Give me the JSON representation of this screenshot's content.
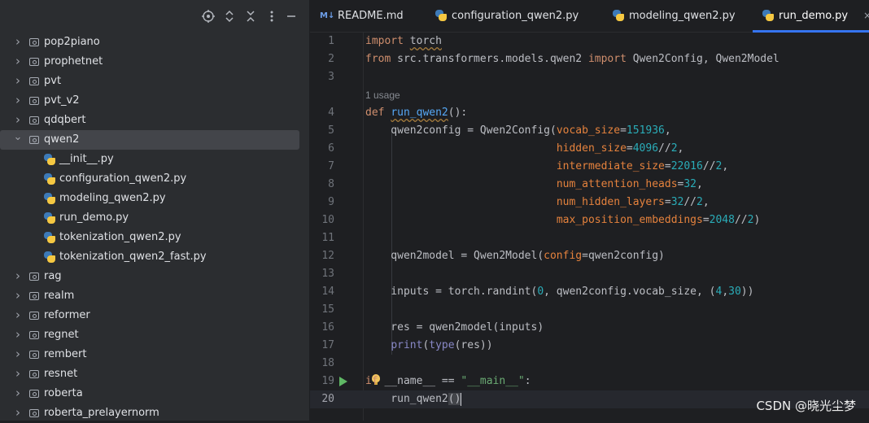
{
  "project": {
    "toolbar": {
      "locate_icon": "crosshair-icon",
      "expand_icon": "expand-collapse-icon",
      "collapse_icon": "collapse-all-icon",
      "options_icon": "more-vertical-icon",
      "hide_icon": "minimize-icon"
    },
    "tree": [
      {
        "type": "folder",
        "label": "pop2piano",
        "expanded": false
      },
      {
        "type": "folder",
        "label": "prophetnet",
        "expanded": false
      },
      {
        "type": "folder",
        "label": "pvt",
        "expanded": false
      },
      {
        "type": "folder",
        "label": "pvt_v2",
        "expanded": false
      },
      {
        "type": "folder",
        "label": "qdqbert",
        "expanded": false
      },
      {
        "type": "folder",
        "label": "qwen2",
        "expanded": true,
        "selected": true
      },
      {
        "type": "file",
        "label": "__init__.py"
      },
      {
        "type": "file",
        "label": "configuration_qwen2.py"
      },
      {
        "type": "file",
        "label": "modeling_qwen2.py"
      },
      {
        "type": "file",
        "label": "run_demo.py"
      },
      {
        "type": "file",
        "label": "tokenization_qwen2.py"
      },
      {
        "type": "file",
        "label": "tokenization_qwen2_fast.py"
      },
      {
        "type": "folder",
        "label": "rag",
        "expanded": false
      },
      {
        "type": "folder",
        "label": "realm",
        "expanded": false
      },
      {
        "type": "folder",
        "label": "reformer",
        "expanded": false
      },
      {
        "type": "folder",
        "label": "regnet",
        "expanded": false
      },
      {
        "type": "folder",
        "label": "rembert",
        "expanded": false
      },
      {
        "type": "folder",
        "label": "resnet",
        "expanded": false
      },
      {
        "type": "folder",
        "label": "roberta",
        "expanded": false
      },
      {
        "type": "folder",
        "label": "roberta_prelayernorm",
        "expanded": false
      }
    ]
  },
  "tabs": [
    {
      "label": "README.md",
      "icon": "M↓",
      "active": false
    },
    {
      "label": "configuration_qwen2.py",
      "icon": "python-icon",
      "active": false
    },
    {
      "label": "modeling_qwen2.py",
      "icon": "python-icon",
      "active": false
    },
    {
      "label": "run_demo.py",
      "icon": "python-icon",
      "active": true,
      "close": "×"
    }
  ],
  "editor": {
    "usage_hint": "1 usage",
    "line_numbers": [
      "1",
      "2",
      "3",
      "4",
      "5",
      "6",
      "7",
      "8",
      "9",
      "10",
      "11",
      "12",
      "13",
      "14",
      "15",
      "16",
      "17",
      "18",
      "19",
      "20"
    ],
    "current_line": "20",
    "lines": [
      [
        [
          "kw",
          "import"
        ],
        [
          "p",
          " "
        ],
        [
          "wp",
          "torch"
        ]
      ],
      [
        [
          "kw",
          "from"
        ],
        [
          "p",
          " src.transformers.models.qwen2 "
        ],
        [
          "kw",
          "import"
        ],
        [
          "p",
          " Qwen2Config, Qwen2Model"
        ]
      ],
      [],
      [
        [
          "kw",
          "def"
        ],
        [
          "p",
          " "
        ],
        [
          "fnw",
          "run_qwen2"
        ],
        [
          "p",
          "():"
        ]
      ],
      [
        [
          "p",
          "    qwen2config = Qwen2Config("
        ],
        [
          "param",
          "vocab_size"
        ],
        [
          "p",
          "="
        ],
        [
          "num",
          "151936"
        ],
        [
          "p",
          ","
        ]
      ],
      [
        [
          "p",
          "                              "
        ],
        [
          "param",
          "hidden_size"
        ],
        [
          "p",
          "="
        ],
        [
          "num",
          "4096"
        ],
        [
          "p",
          "//"
        ],
        [
          "num",
          "2"
        ],
        [
          "p",
          ","
        ]
      ],
      [
        [
          "p",
          "                              "
        ],
        [
          "param",
          "intermediate_size"
        ],
        [
          "p",
          "="
        ],
        [
          "num",
          "22016"
        ],
        [
          "p",
          "//"
        ],
        [
          "num",
          "2"
        ],
        [
          "p",
          ","
        ]
      ],
      [
        [
          "p",
          "                              "
        ],
        [
          "param",
          "num_attention_heads"
        ],
        [
          "p",
          "="
        ],
        [
          "num",
          "32"
        ],
        [
          "p",
          ","
        ]
      ],
      [
        [
          "p",
          "                              "
        ],
        [
          "param",
          "num_hidden_layers"
        ],
        [
          "p",
          "="
        ],
        [
          "num",
          "32"
        ],
        [
          "p",
          "//"
        ],
        [
          "num",
          "2"
        ],
        [
          "p",
          ","
        ]
      ],
      [
        [
          "p",
          "                              "
        ],
        [
          "param",
          "max_position_embeddings"
        ],
        [
          "p",
          "="
        ],
        [
          "num",
          "2048"
        ],
        [
          "p",
          "//"
        ],
        [
          "num",
          "2"
        ],
        [
          "p",
          ")"
        ]
      ],
      [],
      [
        [
          "p",
          "    qwen2model = Qwen2Model("
        ],
        [
          "param",
          "config"
        ],
        [
          "p",
          "=qwen2config)"
        ]
      ],
      [],
      [
        [
          "p",
          "    inputs = torch.randint("
        ],
        [
          "num",
          "0"
        ],
        [
          "p",
          ", qwen2config.vocab_size, ("
        ],
        [
          "num",
          "4"
        ],
        [
          "p",
          ","
        ],
        [
          "num",
          "30"
        ],
        [
          "p",
          "))"
        ]
      ],
      [],
      [
        [
          "p",
          "    res = qwen2model(inputs)"
        ]
      ],
      [
        [
          "p",
          "    "
        ],
        [
          "bi",
          "print"
        ],
        [
          "p",
          "("
        ],
        [
          "bi",
          "type"
        ],
        [
          "p",
          "(res))"
        ]
      ],
      [],
      [
        [
          "kw",
          "if"
        ],
        [
          "p",
          " __name__ == "
        ],
        [
          "str",
          "\"__main__\""
        ],
        [
          "p",
          ":"
        ]
      ],
      [
        [
          "p",
          "    run_qwen2"
        ],
        [
          "hl",
          "()"
        ]
      ]
    ]
  },
  "watermark": "CSDN @晓光尘梦"
}
